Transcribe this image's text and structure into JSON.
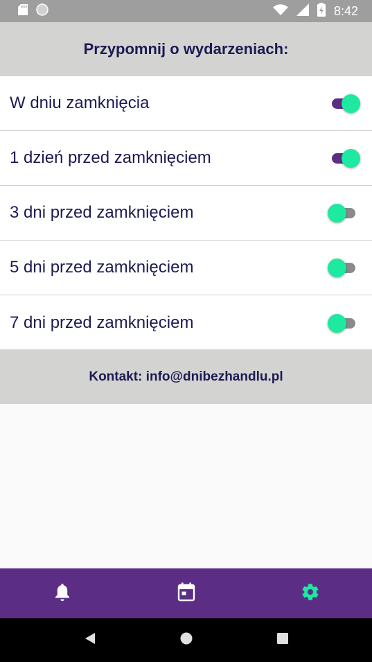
{
  "status_bar": {
    "time": "8:42",
    "left_icons": [
      "sd-card-icon",
      "circle-icon"
    ],
    "right_icons": [
      "wifi-icon",
      "signal-icon",
      "battery-icon"
    ]
  },
  "header": {
    "title": "Przypomnij o wydarzeniach:"
  },
  "reminders": [
    {
      "label": "W dniu zamknięcia",
      "enabled": true
    },
    {
      "label": "1 dzień przed zamknięciem",
      "enabled": true
    },
    {
      "label": "3 dni przed zamknięciem",
      "enabled": false
    },
    {
      "label": "5 dni przed zamknięciem",
      "enabled": false
    },
    {
      "label": "7 dni przed zamknięciem",
      "enabled": false
    }
  ],
  "contact": {
    "text": "Kontakt: info@dnibezhandlu.pl"
  },
  "bottom_nav": {
    "items": [
      {
        "icon": "bell-icon",
        "active": false
      },
      {
        "icon": "calendar-icon",
        "active": false
      },
      {
        "icon": "gear-icon",
        "active": true
      }
    ]
  },
  "colors": {
    "accent": "#1de9a0",
    "primary": "#5b2d84",
    "header_bg": "#d3d4d2",
    "text": "#1c1a52",
    "status_bar_bg": "#9e9e9e"
  }
}
